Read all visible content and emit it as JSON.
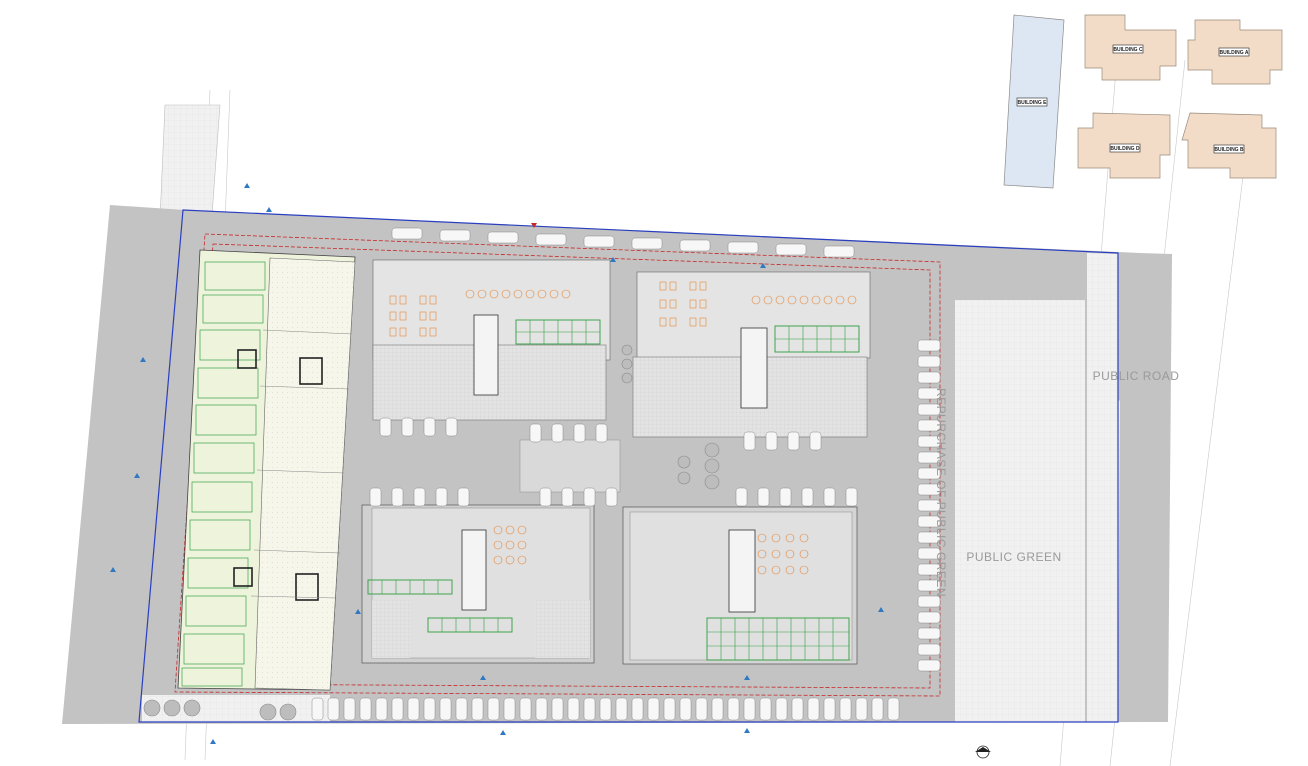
{
  "labels": {
    "public_road": "PUBLIC ROAD",
    "public_green": "PUBLIC GREEN",
    "repurchase": "REPURCHASE OF PUBLIC GREEN"
  },
  "buildings": {
    "a": "BUILDING A",
    "b": "BUILDING B",
    "c": "BUILDING C",
    "d": "BUILDING D",
    "e": "BUILDING E"
  },
  "north_symbol": "north-arrow-icon",
  "colors": {
    "site_boundary": "#2a3fc0",
    "setback_line": "#c62828",
    "neighbour_building": "#f2dcc8",
    "building_e": "#dde7f3",
    "paving": "#d0d0d0",
    "green_planting": "#2e9e3e",
    "chairs": "#e5873a",
    "annotation": "#2f78c4"
  }
}
